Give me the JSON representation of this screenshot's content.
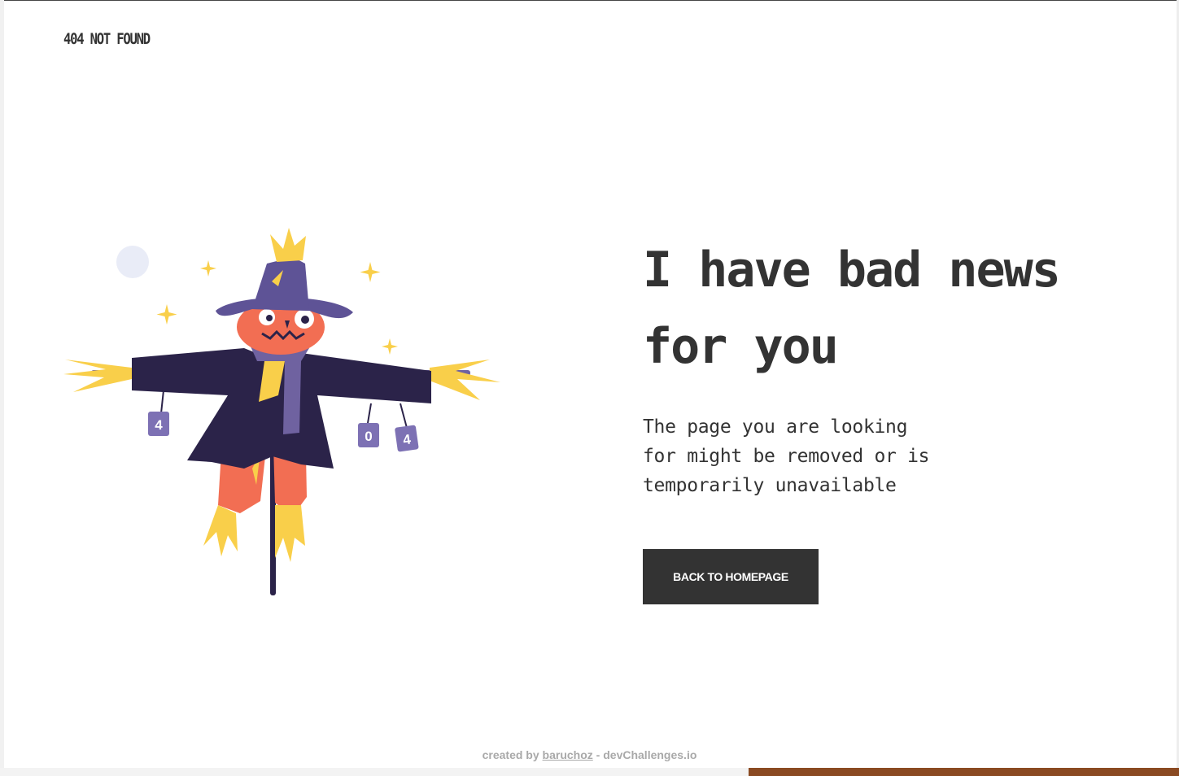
{
  "header": {
    "logo_text": "404 NOT FOUND"
  },
  "main": {
    "headline_line1": "I have bad news",
    "headline_line2": "for you",
    "description_line1": "The page you are looking",
    "description_line2": "for might be removed or is",
    "description_line3": "temporarily unavailable",
    "cta_label": "BACK TO HOMEPAGE"
  },
  "illustration": {
    "icon": "scarecrow-illustration",
    "can_left": "4",
    "can_mid": "0",
    "can_right": "4"
  },
  "footer": {
    "prefix": "created by",
    "author": "baruchoz",
    "separator": "-",
    "site": "devChallenges.io"
  },
  "colors": {
    "text": "#333333",
    "button_bg": "#333333",
    "button_text": "#ffffff",
    "footer_text": "#a9a9a9",
    "hat": "#5e5396",
    "coat": "#2b2349",
    "pumpkin": "#f26e53",
    "straw": "#f9cf4a",
    "scarf": "#6f62a0",
    "moon": "#e9ecf7"
  }
}
